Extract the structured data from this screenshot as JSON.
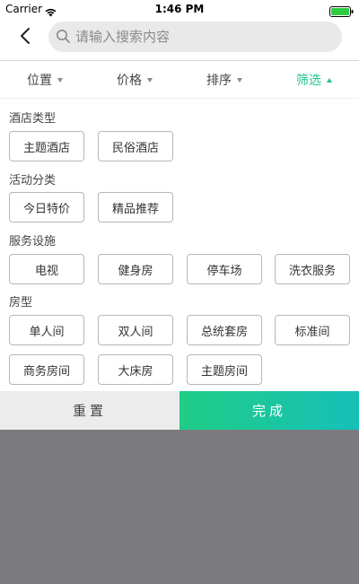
{
  "status_bar": {
    "carrier": "Carrier",
    "time": "1:46 PM",
    "wifi_icon": "wifi-icon",
    "battery_icon": "battery-icon",
    "battery_color": "#2ecc40"
  },
  "nav": {
    "back_icon": "chevron-left-icon",
    "search_placeholder": "请输入搜索内容",
    "search_value": ""
  },
  "tabs": [
    {
      "label": "位置",
      "state": "collapsed"
    },
    {
      "label": "价格",
      "state": "collapsed"
    },
    {
      "label": "排序",
      "state": "collapsed"
    },
    {
      "label": "筛选",
      "state": "expanded"
    }
  ],
  "sections": [
    {
      "title": "酒店类型",
      "options": [
        "主题酒店",
        "民俗酒店"
      ]
    },
    {
      "title": "活动分类",
      "options": [
        "今日特价",
        "精品推荐"
      ]
    },
    {
      "title": "服务设施",
      "options": [
        "电视",
        "健身房",
        "停车场",
        "洗衣服务"
      ]
    },
    {
      "title": "房型",
      "options": [
        "单人间",
        "双人间",
        "总统套房",
        "标准间",
        "商务房间",
        "大床房",
        "主题房间"
      ]
    }
  ],
  "actions": {
    "reset_label": "重置",
    "done_label": "完成"
  },
  "colors": {
    "accent": "#1fc58e",
    "overlay": "#7b7b7f",
    "chip_border": "#b7b7b7"
  }
}
